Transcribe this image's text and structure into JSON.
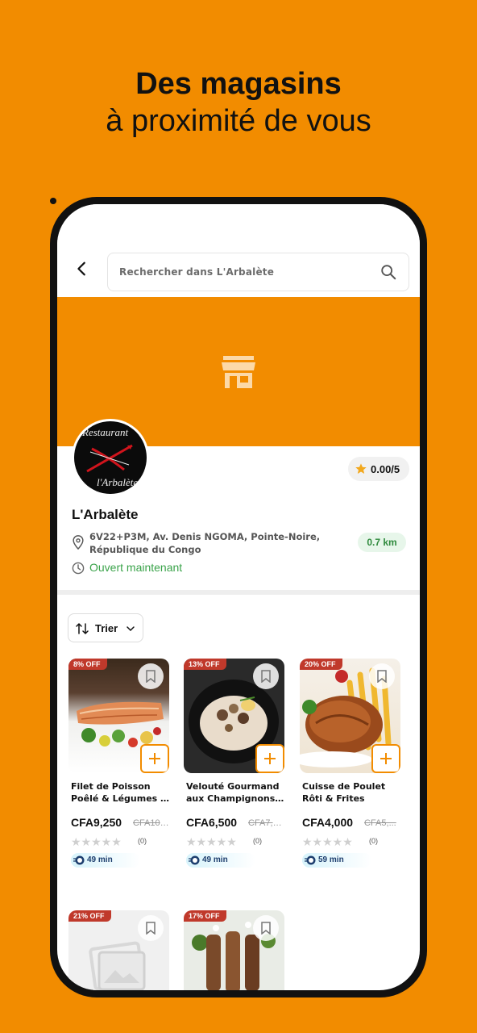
{
  "headline": {
    "line1": "Des magasins",
    "line2": "à proximité de vous"
  },
  "search": {
    "placeholder": "Rechercher dans L'Arbalète"
  },
  "store": {
    "logo_text_top": "Restaurant",
    "logo_text_bottom": "l'Arbalète",
    "rating": "0.00/5",
    "name": "L'Arbalète",
    "address": "6V22+P3M, Av. Denis NGOMA, Pointe-Noire, République du Congo",
    "distance": "0.7 km",
    "status": "Ouvert maintenant"
  },
  "sort": {
    "label": "Trier"
  },
  "products": [
    {
      "discount": "8% OFF",
      "name1": "Filet de Poisson",
      "name2": "Poêlé & Légumes d...",
      "price": "CFA9,250",
      "old_price": "CFA10,...",
      "reviews": "(0)",
      "time": "49 min"
    },
    {
      "discount": "13% OFF",
      "name1": "Velouté Gourmand",
      "name2": "aux Champignons ...",
      "price": "CFA6,500",
      "old_price": "CFA7,5...",
      "reviews": "(0)",
      "time": "49 min"
    },
    {
      "discount": "20% OFF",
      "name1": "Cuisse de Poulet",
      "name2": "Rôti & Frites",
      "price": "CFA4,000",
      "old_price": "CFA5,...",
      "reviews": "(0)",
      "time": "59 min"
    },
    {
      "discount": "21% OFF"
    },
    {
      "discount": "17% OFF"
    }
  ],
  "colors": {
    "brand": "#f28c00",
    "badge": "#c0392b",
    "open": "#3aa34a"
  }
}
